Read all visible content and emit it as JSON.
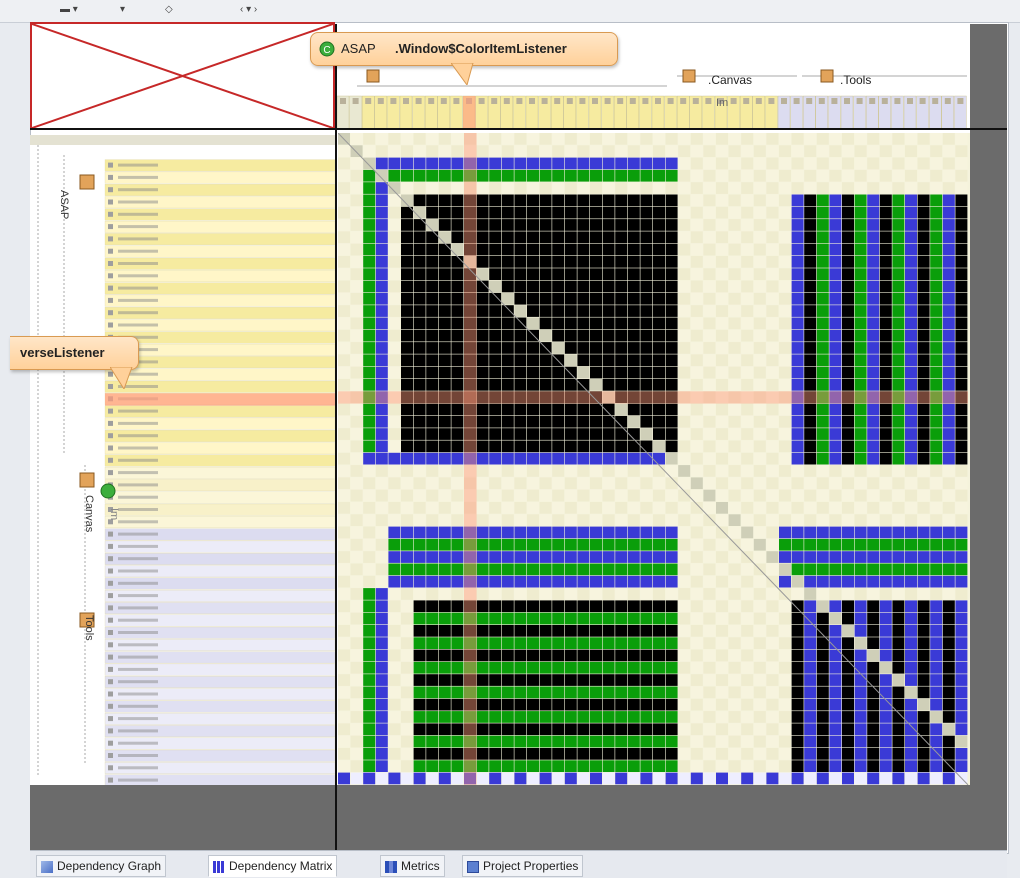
{
  "callouts": {
    "top": {
      "prefix": "ASAP",
      "name": ".Window$ColorItemListener"
    },
    "left": {
      "name": "verseListener"
    }
  },
  "columns": {
    "canvas": ".Canvas",
    "tools": ".Tools",
    "im": "Im"
  },
  "tree": {
    "asap": "ASAP",
    "canvas": "Canvas",
    "tools": "Tools",
    "im": "Im"
  },
  "tabs": [
    {
      "label": "Dependency Graph"
    },
    {
      "label": "Dependency Matrix"
    },
    {
      "label": "Metrics"
    },
    {
      "label": "Project Properties"
    }
  ],
  "colors": {
    "black": "#000000",
    "green": "#0a9e0a",
    "blue": "#3a3ad6",
    "cream": "#f5f3dc",
    "highlight": "#ff9a7a"
  }
}
